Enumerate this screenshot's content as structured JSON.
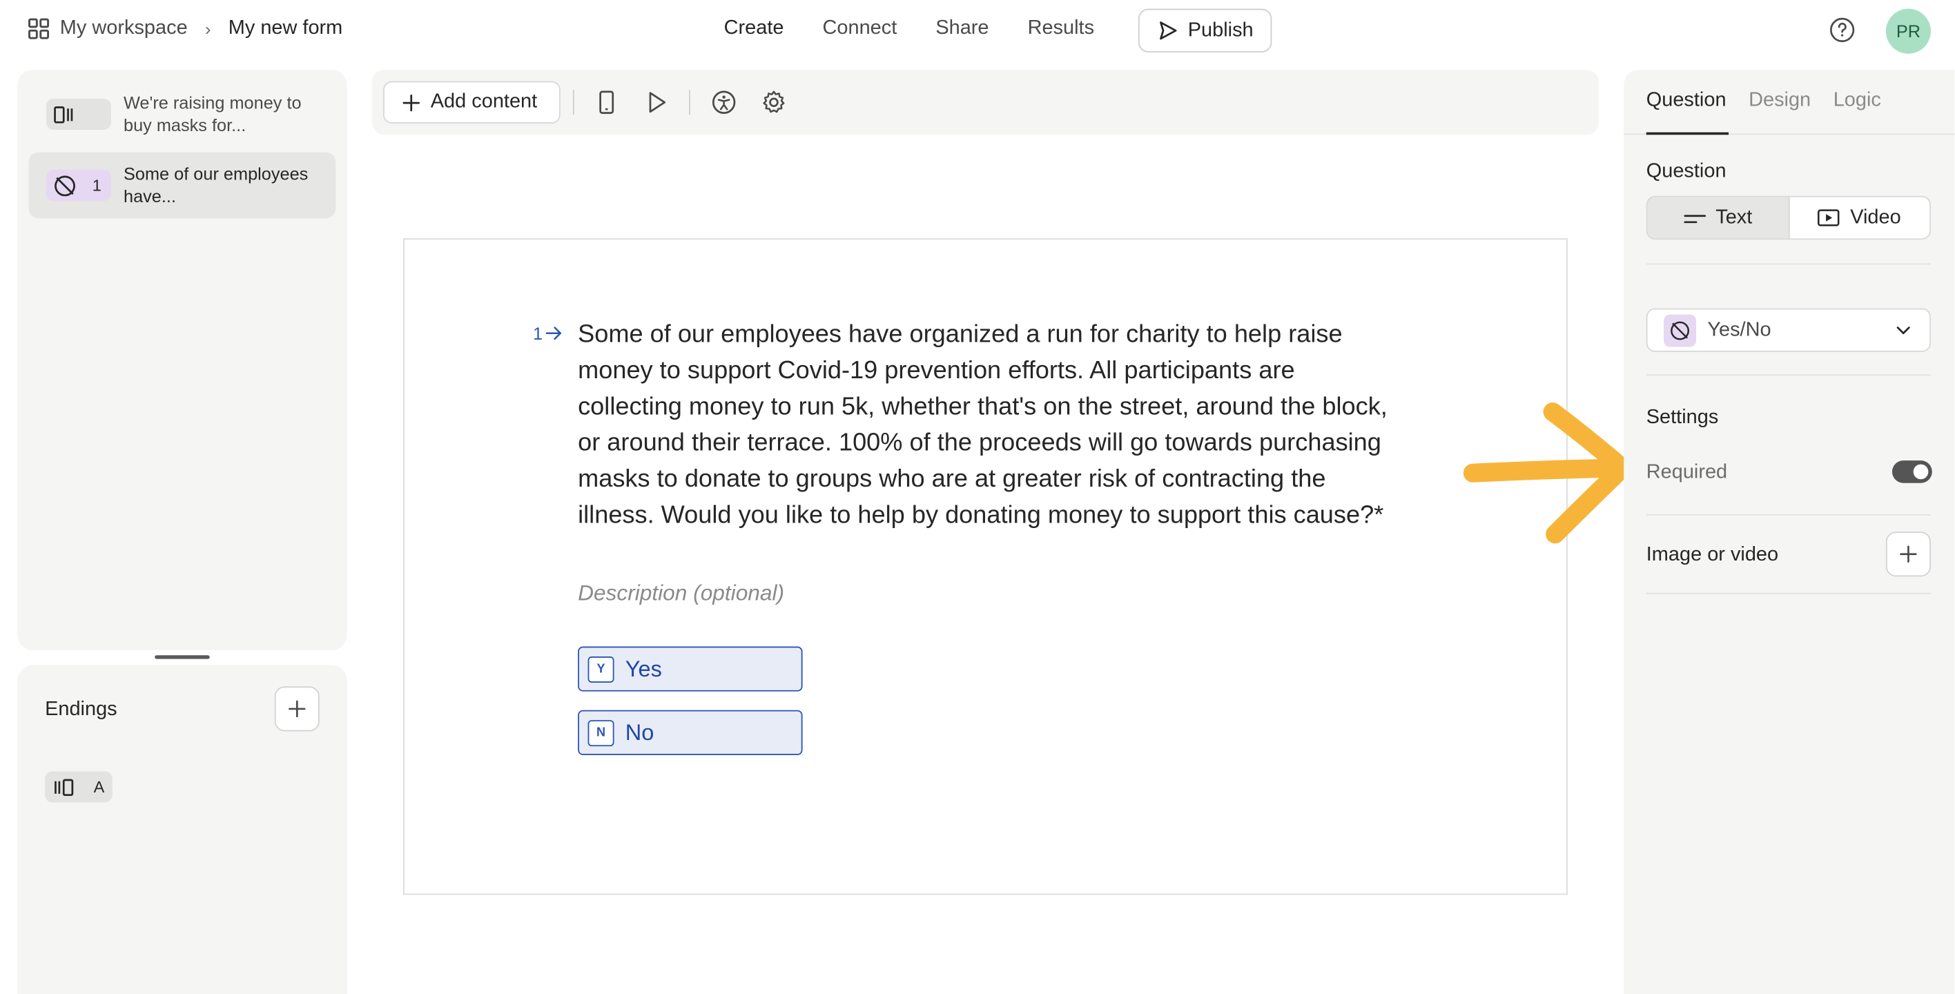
{
  "breadcrumb": {
    "workspace": "My workspace",
    "form": "My new form"
  },
  "nav": {
    "create": "Create",
    "connect": "Connect",
    "share": "Share",
    "results": "Results"
  },
  "publish_label": "Publish",
  "avatar_initials": "PR",
  "questions": [
    {
      "label": "We're raising money to buy masks for...",
      "badge": ""
    },
    {
      "label": "Some of our employees have...",
      "badge": "1"
    }
  ],
  "endings": {
    "title": "Endings",
    "items": [
      {
        "badge": "A"
      }
    ]
  },
  "toolbar": {
    "add_content": "Add content"
  },
  "question": {
    "number": "1",
    "text": "Some of our employees have organized a run for charity to help raise money to support Covid-19 prevention efforts. All participants are collecting money to run 5k, whether that's on the street, around the block, or around their terrace. 100% of the proceeds will go towards purchasing masks to donate to groups who are at greater risk of contracting the illness. Would you like to help by donating money to support this cause?*",
    "description_placeholder": "Description (optional)",
    "choices": [
      {
        "key": "Y",
        "label": "Yes"
      },
      {
        "key": "N",
        "label": "No"
      }
    ]
  },
  "panel": {
    "tabs": [
      "Question",
      "Design",
      "Logic"
    ],
    "question_heading": "Question",
    "format_text": "Text",
    "format_video": "Video",
    "type_label": "Yes/No",
    "settings_heading": "Settings",
    "required_label": "Required",
    "required_on": true,
    "image_video_label": "Image or video"
  },
  "colors": {
    "accent": "#2a56b5",
    "arrow": "#f6b53a",
    "avatar_bg": "#a9e0c4",
    "yesno_chip": "#e6d7f2"
  }
}
